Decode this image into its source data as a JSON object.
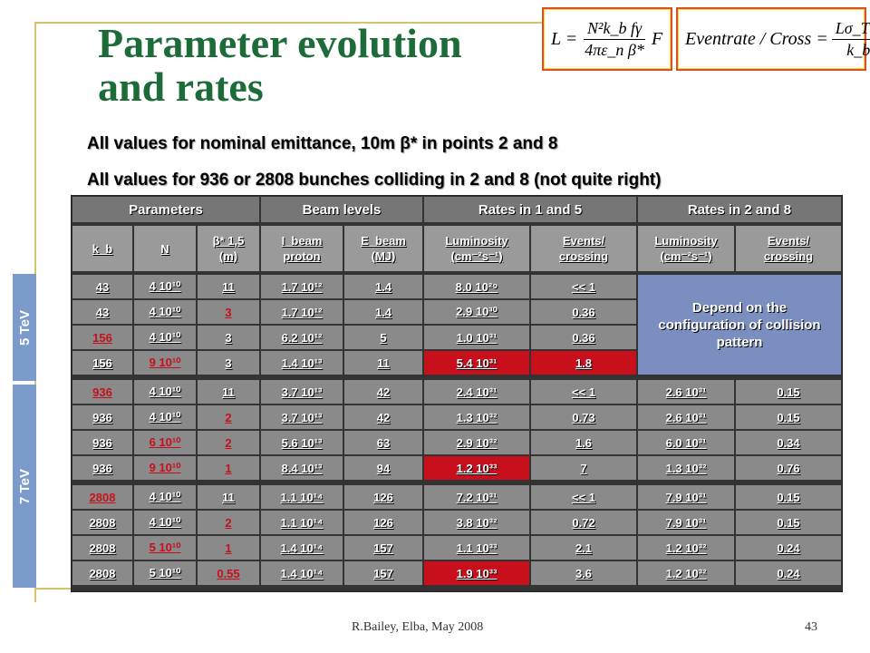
{
  "title": "Parameter evolution and rates",
  "formulas": {
    "luminosity": {
      "lhs": "L =",
      "num": "N²k_b fγ",
      "den": "4πε_n β*",
      "rhs": "F"
    },
    "eventrate": {
      "lhs": "Eventrate / Cross =",
      "num": "Lσ_TOT",
      "den": "k_b f"
    }
  },
  "subtitles": [
    "All values for nominal emittance, 10m β* in points 2 and 8",
    "All values for 936 or 2808 bunches colliding in 2 and 8 (not quite right)"
  ],
  "side_labels": {
    "e5": "5 TeV",
    "e7": "7 TeV"
  },
  "table": {
    "groups": [
      "Parameters",
      "Beam levels",
      "Rates in 1 and 5",
      "Rates in 2 and 8"
    ],
    "subheaders": [
      {
        "l1": "k_b",
        "l2": ""
      },
      {
        "l1": "N",
        "l2": ""
      },
      {
        "l1": "β* 1,5",
        "l2": "(m)"
      },
      {
        "l1": "I_beam",
        "l2": "proton"
      },
      {
        "l1": "E_beam",
        "l2": "(MJ)"
      },
      {
        "l1": "Luminosity",
        "l2": "(cm⁻²s⁻¹)"
      },
      {
        "l1": "Events/",
        "l2": "crossing"
      },
      {
        "l1": "Luminosity",
        "l2": "(cm⁻²s⁻¹)"
      },
      {
        "l1": "Events/",
        "l2": "crossing"
      }
    ],
    "merged_note": "Depend on the configuration of collision pattern",
    "rows": [
      [
        "43",
        "4 10¹⁰",
        "11",
        "1.7 10¹²",
        "1.4",
        "8.0 10²⁹",
        "<< 1",
        "",
        ""
      ],
      [
        "43",
        "4 10¹⁰",
        "3",
        "1.7 10¹²",
        "1.4",
        "2.9 10³⁰",
        "0.36",
        "",
        ""
      ],
      [
        "156",
        "4 10¹⁰",
        "3",
        "6.2 10¹²",
        "5",
        "1.0 10³¹",
        "0.36",
        "",
        ""
      ],
      [
        "156",
        "9 10¹⁰",
        "3",
        "1.4 10¹³",
        "11",
        "5.4 10³¹",
        "1.8",
        "",
        ""
      ],
      [
        "936",
        "4 10¹⁰",
        "11",
        "3.7 10¹³",
        "42",
        "2.4 10³¹",
        "<< 1",
        "2.6 10³¹",
        "0.15"
      ],
      [
        "936",
        "4 10¹⁰",
        "2",
        "3.7 10¹³",
        "42",
        "1.3 10³²",
        "0.73",
        "2.6 10³¹",
        "0.15"
      ],
      [
        "936",
        "6 10¹⁰",
        "2",
        "5.6 10¹³",
        "63",
        "2.9 10³²",
        "1.6",
        "6.0 10³¹",
        "0.34"
      ],
      [
        "936",
        "9 10¹⁰",
        "1",
        "8.4 10¹³",
        "94",
        "1.2 10³³",
        "7",
        "1.3 10³²",
        "0.76"
      ],
      [
        "2808",
        "4 10¹⁰",
        "11",
        "1.1 10¹⁴",
        "126",
        "7.2 10³¹",
        "<< 1",
        "7.9 10³¹",
        "0.15"
      ],
      [
        "2808",
        "4 10¹⁰",
        "2",
        "1.1 10¹⁴",
        "126",
        "3.8 10³²",
        "0.72",
        "7.9 10³¹",
        "0.15"
      ],
      [
        "2808",
        "5 10¹⁰",
        "1",
        "1.4 10¹⁴",
        "157",
        "1.1 10³³",
        "2.1",
        "1.2 10³²",
        "0.24"
      ],
      [
        "2808",
        "5 10¹⁰",
        "0.55",
        "1.4 10¹⁴",
        "157",
        "1.9 10³³",
        "3.6",
        "1.2 10³²",
        "0.24"
      ]
    ],
    "red_bg_cells": [
      [
        3,
        5
      ],
      [
        3,
        6
      ],
      [
        7,
        5
      ],
      [
        11,
        5
      ]
    ],
    "red_text_cells": [
      [
        2,
        0
      ],
      [
        4,
        0
      ],
      [
        8,
        0
      ],
      [
        1,
        2
      ],
      [
        5,
        2
      ],
      [
        6,
        2
      ],
      [
        7,
        2
      ],
      [
        9,
        2
      ],
      [
        10,
        2
      ],
      [
        11,
        2
      ],
      [
        3,
        1
      ],
      [
        6,
        1
      ],
      [
        7,
        1
      ],
      [
        10,
        1
      ]
    ],
    "colors": {
      "red": "#c8101c",
      "cell": "#8a8a8a",
      "header": "#767676",
      "note": "#7a8fc0",
      "side": "#7b9ccb"
    }
  },
  "footer": {
    "left": "R.Bailey, Elba, May 2008",
    "right": "43"
  }
}
